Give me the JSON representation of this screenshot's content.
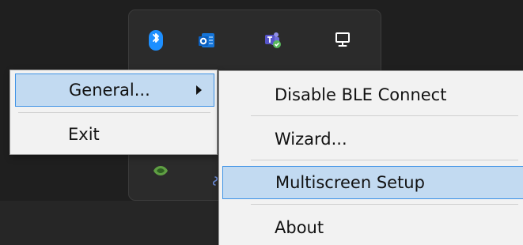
{
  "tray": {
    "icons": [
      "bluetooth-icon",
      "outlook-icon",
      "teams-icon",
      "computer-icon",
      "nvidia-icon",
      "small-tray-icon"
    ]
  },
  "menu_left": {
    "items": [
      {
        "label": "General...",
        "has_submenu": true,
        "selected": true
      },
      {
        "label": "Exit",
        "has_submenu": false,
        "selected": false
      }
    ]
  },
  "menu_right": {
    "items": [
      {
        "label": "Disable BLE Connect",
        "selected": false
      },
      {
        "label": "Wizard...",
        "selected": false
      },
      {
        "label": "Multiscreen Setup",
        "selected": true
      },
      {
        "label": "About",
        "selected": false
      }
    ]
  },
  "colors": {
    "selection_fill": "#c2daf1",
    "selection_border": "#3f93e6",
    "bluetooth_accent": "#1d8fff",
    "menu_bg": "#f2f2f2",
    "tray_bg": "#2b2b2b"
  }
}
